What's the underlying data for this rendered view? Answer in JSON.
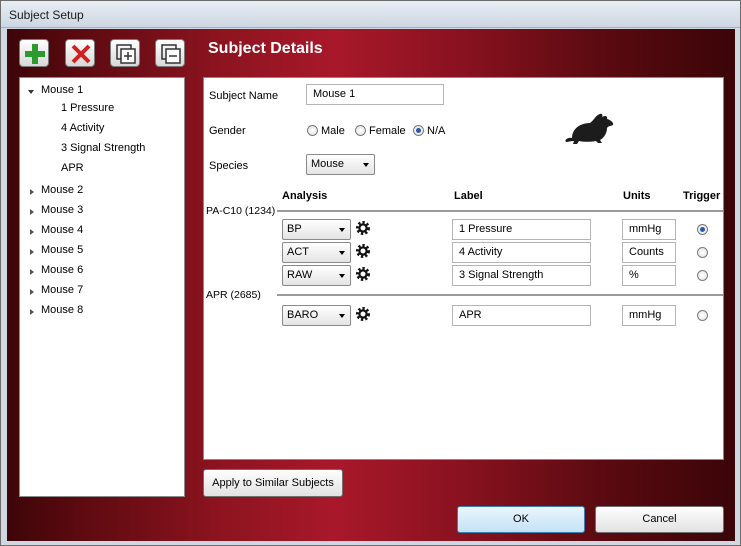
{
  "window": {
    "title": "Subject Setup"
  },
  "toolbar": {
    "icons": [
      "add-icon",
      "delete-icon",
      "expand-all-icon",
      "collapse-all-icon"
    ]
  },
  "details": {
    "title": "Subject Details"
  },
  "tree": {
    "subjects": [
      {
        "label": "Mouse 1",
        "expanded": true,
        "children": [
          "1  Pressure",
          "4  Activity",
          "3  Signal Strength",
          "APR"
        ]
      },
      {
        "label": "Mouse 2"
      },
      {
        "label": "Mouse 3"
      },
      {
        "label": "Mouse 4"
      },
      {
        "label": "Mouse 5"
      },
      {
        "label": "Mouse 6"
      },
      {
        "label": "Mouse 7"
      },
      {
        "label": "Mouse 8"
      }
    ]
  },
  "form": {
    "subject_name_label": "Subject Name",
    "subject_name_value": "Mouse 1",
    "gender_label": "Gender",
    "gender_options": [
      "Male",
      "Female",
      "N/A"
    ],
    "gender_selected": "N/A",
    "species_label": "Species",
    "species_value": "Mouse"
  },
  "table": {
    "headers": {
      "analysis": "Analysis",
      "label": "Label",
      "units": "Units",
      "trigger": "Trigger"
    },
    "groups": [
      {
        "name": "PA-C10 (1234)",
        "rows": [
          {
            "analysis": "BP",
            "label": "1  Pressure",
            "units": "mmHg",
            "trigger": true
          },
          {
            "analysis": "ACT",
            "label": "4  Activity",
            "units": "Counts",
            "trigger": false
          },
          {
            "analysis": "RAW",
            "label": "3  Signal Strength",
            "units": "%",
            "trigger": false
          }
        ]
      },
      {
        "name": "APR (2685)",
        "rows": [
          {
            "analysis": "BARO",
            "label": "APR",
            "units": "mmHg",
            "trigger": false
          }
        ]
      }
    ]
  },
  "buttons": {
    "apply": "Apply to Similar Subjects",
    "ok": "OK",
    "cancel": "Cancel"
  }
}
